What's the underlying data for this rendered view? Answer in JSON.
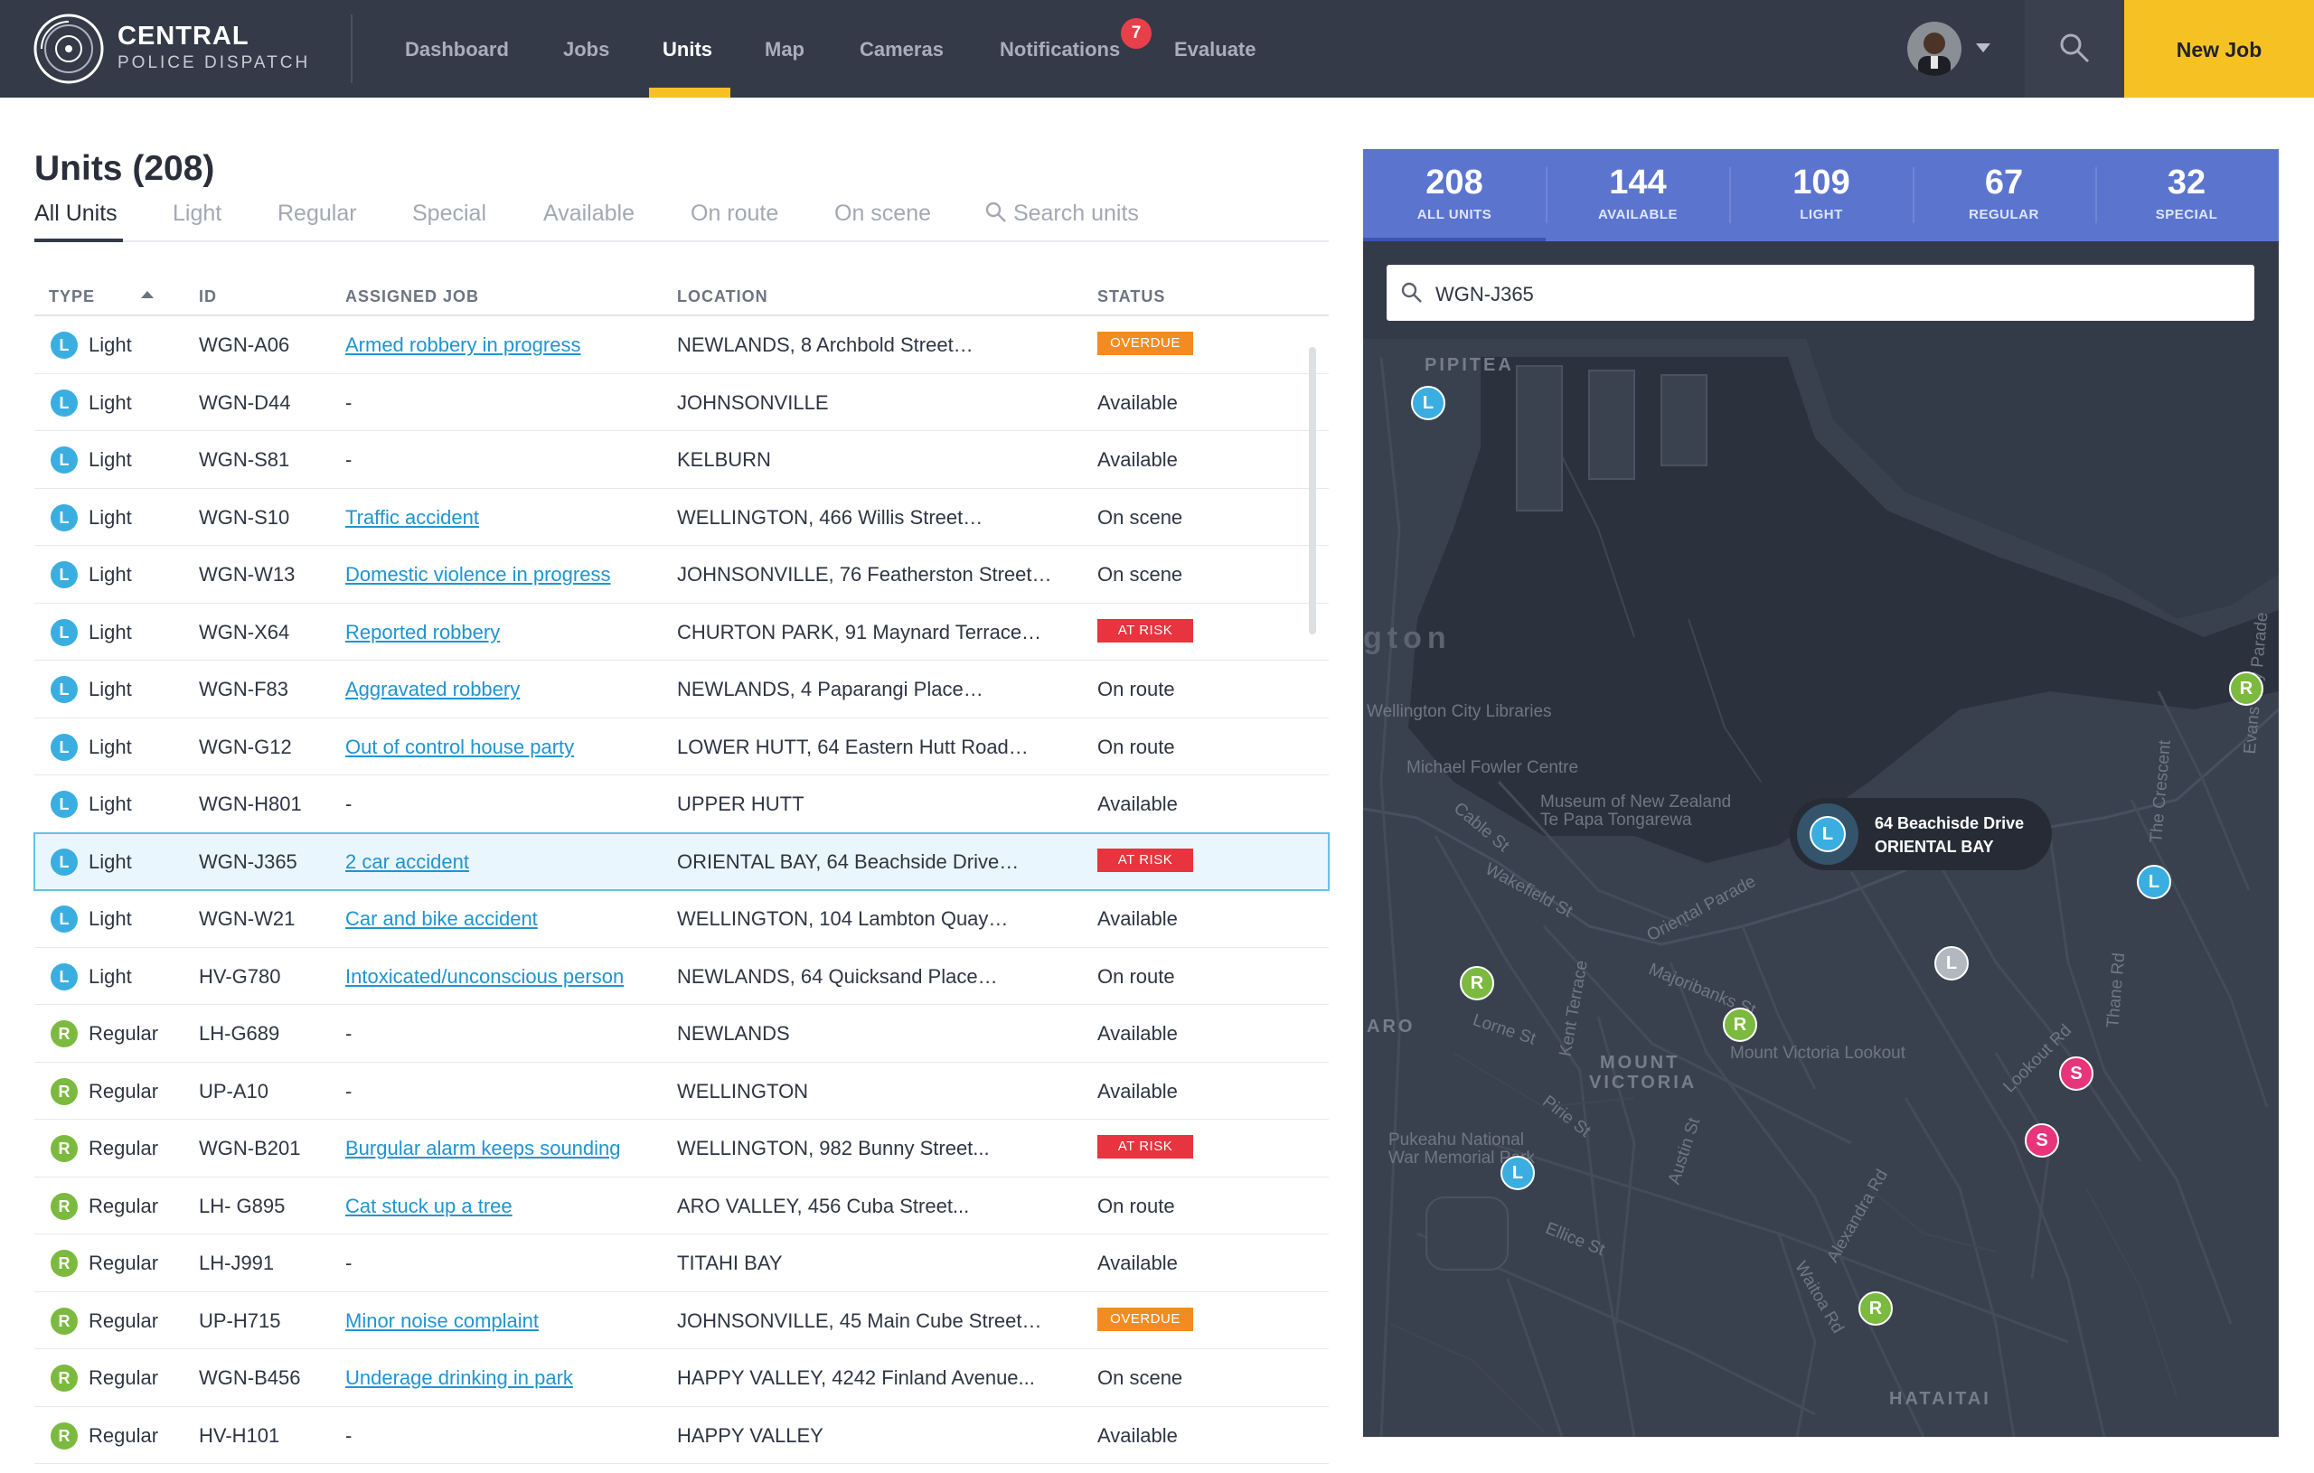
{
  "brand": {
    "line1": "CENTRAL",
    "line2": "POLICE DISPATCH"
  },
  "nav": {
    "items": [
      "Dashboard",
      "Jobs",
      "Units",
      "Map",
      "Cameras",
      "Notifications",
      "Evaluate"
    ],
    "active": "Units",
    "notifications_count": "7"
  },
  "header": {
    "new_job_label": "New Job"
  },
  "units": {
    "title": "Units (208)",
    "tabs": [
      "All Units",
      "Light",
      "Regular",
      "Special",
      "Available",
      "On route",
      "On scene"
    ],
    "search_placeholder": "Search units",
    "columns": [
      "TYPE",
      "ID",
      "ASSIGNED JOB",
      "LOCATION",
      "STATUS"
    ],
    "rows": [
      {
        "badge": "L",
        "type": "Light",
        "id": "WGN-A06",
        "job": "Armed robbery in progress",
        "location": "NEWLANDS, 8 Archbold Street…",
        "status": "OVERDUE",
        "tag": "overdue"
      },
      {
        "badge": "L",
        "type": "Light",
        "id": "WGN-D44",
        "job": "-",
        "location": "JOHNSONVILLE",
        "status": "Available",
        "tag": ""
      },
      {
        "badge": "L",
        "type": "Light",
        "id": "WGN-S81",
        "job": "-",
        "location": "KELBURN",
        "status": "Available",
        "tag": ""
      },
      {
        "badge": "L",
        "type": "Light",
        "id": "WGN-S10",
        "job": "Traffic accident",
        "location": "WELLINGTON, 466 Willis Street…",
        "status": "On scene",
        "tag": ""
      },
      {
        "badge": "L",
        "type": "Light",
        "id": "WGN-W13",
        "job": "Domestic violence in progress",
        "location": "JOHNSONVILLE, 76 Featherston Street…",
        "status": "On scene",
        "tag": ""
      },
      {
        "badge": "L",
        "type": "Light",
        "id": "WGN-X64",
        "job": "Reported robbery",
        "location": "CHURTON PARK, 91 Maynard Terrace…",
        "status": "AT RISK",
        "tag": "risk"
      },
      {
        "badge": "L",
        "type": "Light",
        "id": "WGN-F83",
        "job": "Aggravated robbery",
        "location": "NEWLANDS, 4 Paparangi Place…",
        "status": "On route",
        "tag": ""
      },
      {
        "badge": "L",
        "type": "Light",
        "id": "WGN-G12",
        "job": "Out of control house party",
        "location": "LOWER HUTT, 64 Eastern Hutt Road…",
        "status": "On route",
        "tag": ""
      },
      {
        "badge": "L",
        "type": "Light",
        "id": "WGN-H801",
        "job": "-",
        "location": "UPPER HUTT",
        "status": "Available",
        "tag": ""
      },
      {
        "badge": "L",
        "type": "Light",
        "id": "WGN-J365",
        "job": "2 car accident",
        "location": "ORIENTAL BAY, 64 Beachside Drive…",
        "status": "AT RISK",
        "tag": "risk",
        "selected": true
      },
      {
        "badge": "L",
        "type": "Light",
        "id": "WGN-W21",
        "job": "Car and bike accident",
        "location": "WELLINGTON, 104 Lambton Quay…",
        "status": "Available",
        "tag": ""
      },
      {
        "badge": "L",
        "type": "Light",
        "id": "HV-G780",
        "job": "Intoxicated/unconscious person",
        "location": "NEWLANDS, 64 Quicksand Place…",
        "status": "On route",
        "tag": ""
      },
      {
        "badge": "R",
        "type": "Regular",
        "id": "LH-G689",
        "job": "-",
        "location": "NEWLANDS",
        "status": "Available",
        "tag": ""
      },
      {
        "badge": "R",
        "type": "Regular",
        "id": "UP-A10",
        "job": "-",
        "location": "WELLINGTON",
        "status": "Available",
        "tag": ""
      },
      {
        "badge": "R",
        "type": "Regular",
        "id": "WGN-B201",
        "job": "Burgular alarm keeps sounding",
        "location": "WELLINGTON, 982 Bunny Street...",
        "status": "AT RISK",
        "tag": "risk"
      },
      {
        "badge": "R",
        "type": "Regular",
        "id": "LH- G895",
        "job": "Cat stuck up a tree",
        "location": "ARO VALLEY, 456 Cuba Street...",
        "status": "On route",
        "tag": ""
      },
      {
        "badge": "R",
        "type": "Regular",
        "id": "LH-J991",
        "job": "-",
        "location": "TITAHI BAY",
        "status": "Available",
        "tag": ""
      },
      {
        "badge": "R",
        "type": "Regular",
        "id": "UP-H715",
        "job": "Minor noise complaint",
        "location": "JOHNSONVILLE, 45 Main Cube Street…",
        "status": "OVERDUE",
        "tag": "overdue"
      },
      {
        "badge": "R",
        "type": "Regular",
        "id": "WGN-B456",
        "job": "Underage drinking in park",
        "location": "HAPPY VALLEY, 4242 Finland Avenue...",
        "status": "On scene",
        "tag": ""
      },
      {
        "badge": "R",
        "type": "Regular",
        "id": "HV-H101",
        "job": "-",
        "location": "HAPPY VALLEY",
        "status": "Available",
        "tag": ""
      }
    ]
  },
  "map": {
    "stats": [
      {
        "value": "208",
        "label": "ALL UNITS"
      },
      {
        "value": "144",
        "label": "AVAILABLE"
      },
      {
        "value": "109",
        "label": "LIGHT"
      },
      {
        "value": "67",
        "label": "REGULAR"
      },
      {
        "value": "32",
        "label": "SPECIAL"
      }
    ],
    "search_value": "WGN-J365",
    "callout": {
      "line1": "64 Beachisde Drive",
      "line2": "ORIENTAL BAY",
      "badge": "L"
    },
    "place_labels": {
      "pipitea": "PIPITEA",
      "gton": "gton",
      "libraries": "Wellington City Libraries",
      "fowler": "Michael Fowler Centre",
      "museum1": "Museum of New Zealand",
      "museum2": "Te Papa Tongarewa",
      "mount1": "MOUNT",
      "mount2": "VICTORIA",
      "lookout": "Mount Victoria Lookout",
      "aro": "ARO",
      "pukeahu1": "Pukeahu National",
      "pukeahu2": "War Memorial Park",
      "hataitai": "HATAITAI",
      "oriental_parade": "Oriental Parade",
      "wakefield": "Wakefield St",
      "cable": "Cable St",
      "lorne": "Lorne St",
      "kent": "Kent Terrace",
      "majoribanks": "Majoribanks St",
      "pirie": "Pirie St",
      "ellice": "Ellice St",
      "austin": "Austin St",
      "thane": "Thane Rd",
      "crescent": "The Crescent",
      "lookout_rd": "Lookout Rd",
      "evans": "Evans Bay Parade",
      "alexandra": "Alexandra Rd",
      "waitoa": "Waitoa Rd"
    },
    "markers": [
      "L",
      "R",
      "L",
      "R",
      "L",
      "R",
      "S",
      "S",
      "L",
      "R",
      "L"
    ]
  }
}
